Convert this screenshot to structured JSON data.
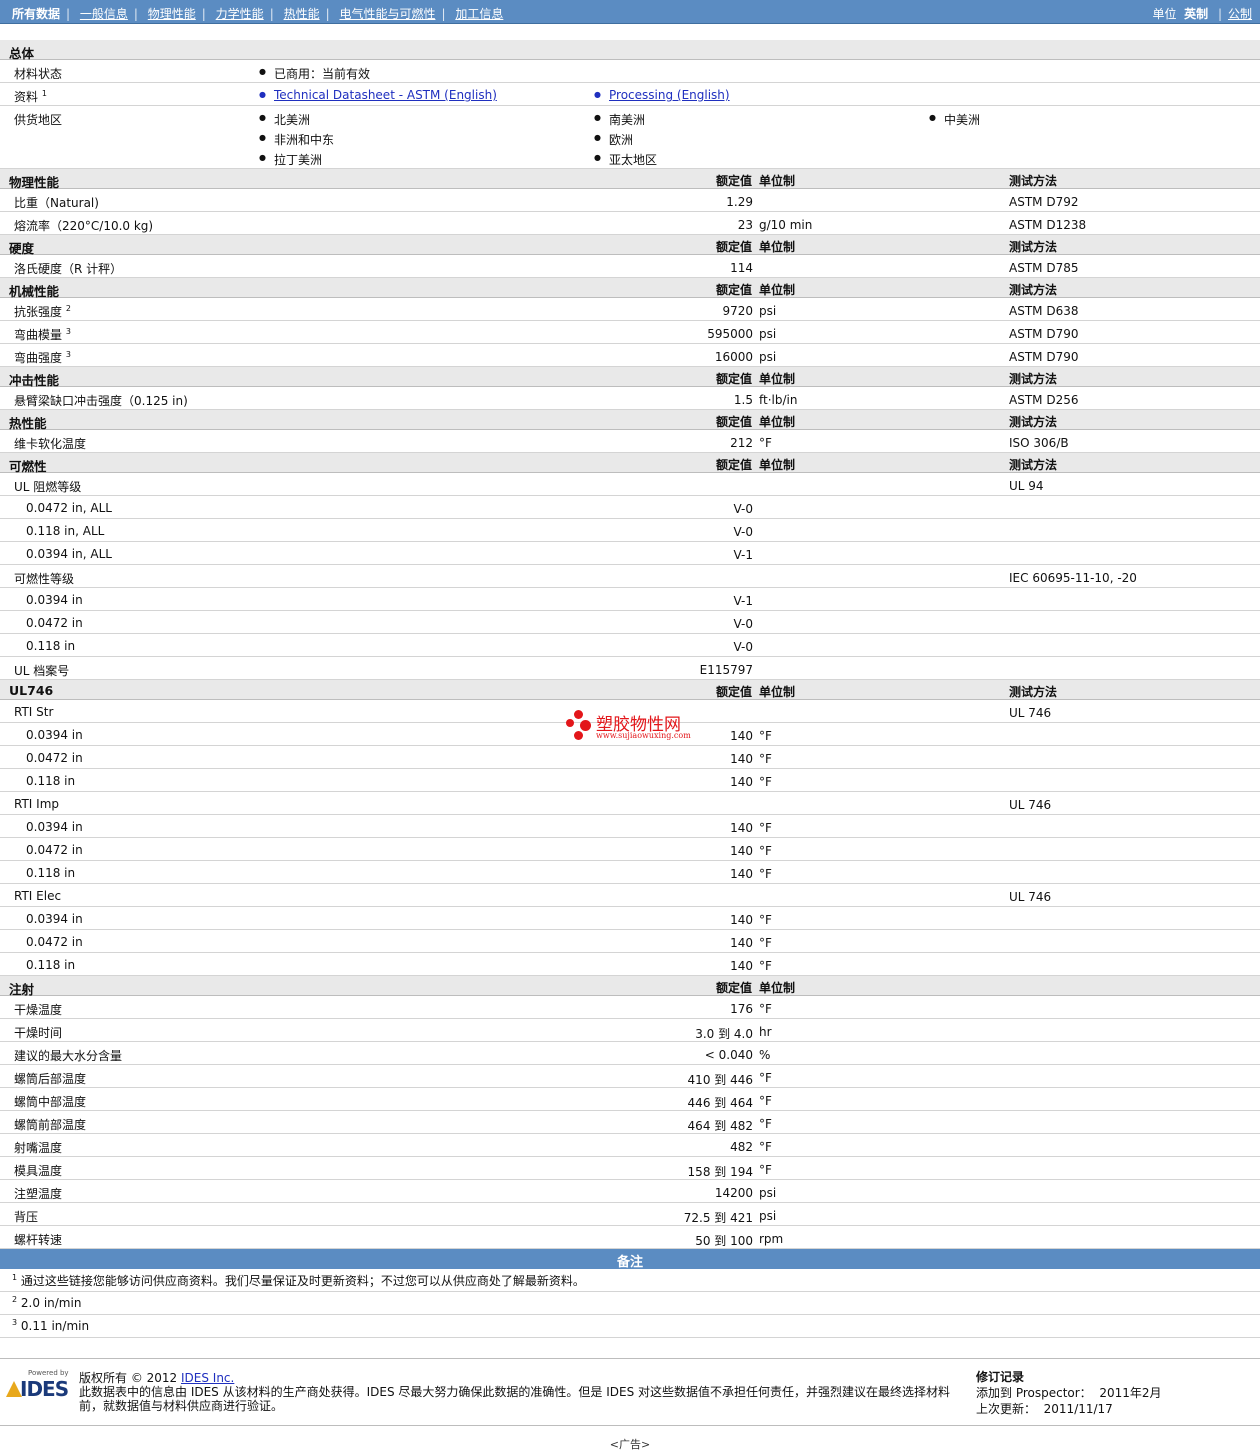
{
  "nav": {
    "tabs": [
      "所有数据",
      "一般信息",
      "物理性能",
      "力学性能",
      "热性能",
      "电气性能与可燃性",
      "加工信息"
    ],
    "units_label": "单位",
    "unit_english": "英制",
    "unit_metric": "公制"
  },
  "table_header": {
    "value": "额定值",
    "unit": "单位制",
    "method": "测试方法"
  },
  "general": {
    "title": "总体",
    "status_label": "材料状态",
    "status_value": "已商用：当前有效",
    "docs_label": "资料",
    "docs_sup": "1",
    "doc1": "Technical Datasheet - ASTM (English)",
    "doc2": "Processing (English)",
    "regions_label": "供货地区",
    "regions": [
      "北美洲",
      "南美洲",
      "中美洲",
      "非洲和中东",
      "欧洲",
      "拉丁美洲",
      "亚太地区"
    ]
  },
  "sections": [
    {
      "title": "物理性能",
      "rows": [
        {
          "label": "比重（Natural)",
          "value": "1.29",
          "unit": "",
          "method": "ASTM D792"
        },
        {
          "label": "熔流率（220°C/10.0 kg)",
          "value": "23",
          "unit": "g/10 min",
          "method": "ASTM D1238"
        }
      ]
    },
    {
      "title": "硬度",
      "rows": [
        {
          "label": "洛氏硬度（R 计秤）",
          "value": "114",
          "unit": "",
          "method": "ASTM D785"
        }
      ]
    },
    {
      "title": "机械性能",
      "rows": [
        {
          "label": "抗张强度",
          "sup": "2",
          "value": "9720",
          "unit": "psi",
          "method": "ASTM D638"
        },
        {
          "label": "弯曲模量",
          "sup": "3",
          "value": "595000",
          "unit": "psi",
          "method": "ASTM D790"
        },
        {
          "label": "弯曲强度",
          "sup": "3",
          "value": "16000",
          "unit": "psi",
          "method": "ASTM D790"
        }
      ]
    },
    {
      "title": "冲击性能",
      "rows": [
        {
          "label": "悬臂梁缺口冲击强度（0.125 in)",
          "value": "1.5",
          "unit": "ft·lb/in",
          "method": "ASTM D256"
        }
      ]
    },
    {
      "title": "热性能",
      "rows": [
        {
          "label": "维卡软化温度",
          "value": "212",
          "unit": "°F",
          "method": "ISO 306/B"
        }
      ]
    },
    {
      "title": "可燃性",
      "rows": [
        {
          "label": "UL 阻燃等级",
          "value": "",
          "unit": "",
          "method": "UL 94"
        },
        {
          "label": "0.0472 in, ALL",
          "sub": true,
          "value": "V-0",
          "unit": "",
          "method": ""
        },
        {
          "label": "0.118 in, ALL",
          "sub": true,
          "value": "V-0",
          "unit": "",
          "method": ""
        },
        {
          "label": "0.0394 in, ALL",
          "sub": true,
          "value": "V-1",
          "unit": "",
          "method": ""
        },
        {
          "label": "可燃性等级",
          "value": "",
          "unit": "",
          "method": "IEC 60695-11-10, -20"
        },
        {
          "label": "0.0394 in",
          "sub": true,
          "value": "V-1",
          "unit": "",
          "method": ""
        },
        {
          "label": "0.0472 in",
          "sub": true,
          "value": "V-0",
          "unit": "",
          "method": ""
        },
        {
          "label": "0.118 in",
          "sub": true,
          "value": "V-0",
          "unit": "",
          "method": ""
        },
        {
          "label": "UL 档案号",
          "value": "E115797",
          "unit": "",
          "method": ""
        }
      ]
    },
    {
      "title": "UL746",
      "rows": [
        {
          "label": "RTI Str",
          "value": "",
          "unit": "",
          "method": "UL 746"
        },
        {
          "label": "0.0394 in",
          "sub": true,
          "value": "140",
          "unit": "°F",
          "method": ""
        },
        {
          "label": "0.0472 in",
          "sub": true,
          "value": "140",
          "unit": "°F",
          "method": ""
        },
        {
          "label": "0.118 in",
          "sub": true,
          "value": "140",
          "unit": "°F",
          "method": ""
        },
        {
          "label": "RTI Imp",
          "value": "",
          "unit": "",
          "method": "UL 746"
        },
        {
          "label": "0.0394 in",
          "sub": true,
          "value": "140",
          "unit": "°F",
          "method": ""
        },
        {
          "label": "0.0472 in",
          "sub": true,
          "value": "140",
          "unit": "°F",
          "method": ""
        },
        {
          "label": "0.118 in",
          "sub": true,
          "value": "140",
          "unit": "°F",
          "method": ""
        },
        {
          "label": "RTI Elec",
          "value": "",
          "unit": "",
          "method": "UL 746"
        },
        {
          "label": "0.0394 in",
          "sub": true,
          "value": "140",
          "unit": "°F",
          "method": ""
        },
        {
          "label": "0.0472 in",
          "sub": true,
          "value": "140",
          "unit": "°F",
          "method": ""
        },
        {
          "label": "0.118 in",
          "sub": true,
          "value": "140",
          "unit": "°F",
          "method": ""
        }
      ]
    },
    {
      "title": "注射",
      "nomethod": true,
      "rows": [
        {
          "label": "干燥温度",
          "value": "176",
          "unit": "°F",
          "method": ""
        },
        {
          "label": "干燥时间",
          "value": "3.0 到  4.0",
          "unit": "hr",
          "method": ""
        },
        {
          "label": "建议的最大水分含量",
          "value": "< 0.040",
          "unit": "%",
          "method": ""
        },
        {
          "label": "螺筒后部温度",
          "value": "410 到  446",
          "unit": "°F",
          "method": ""
        },
        {
          "label": "螺筒中部温度",
          "value": "446 到  464",
          "unit": "°F",
          "method": ""
        },
        {
          "label": "螺筒前部温度",
          "value": "464 到  482",
          "unit": "°F",
          "method": ""
        },
        {
          "label": "射嘴温度",
          "value": "482",
          "unit": "°F",
          "method": ""
        },
        {
          "label": "模具温度",
          "value": "158 到  194",
          "unit": "°F",
          "method": ""
        },
        {
          "label": "注塑温度",
          "value": "14200",
          "unit": "psi",
          "method": ""
        },
        {
          "label": "背压",
          "value": "72.5 到  421",
          "unit": "psi",
          "method": ""
        },
        {
          "label": "螺杆转速",
          "value": "50 到  100",
          "unit": "rpm",
          "method": ""
        }
      ]
    }
  ],
  "notes": {
    "title": "备注",
    "items": [
      {
        "sup": "1",
        "text": "通过这些链接您能够访问供应商资料。我们尽量保证及时更新资料；不过您可以从供应商处了解最新资料。"
      },
      {
        "sup": "2",
        "text": "2.0 in/min"
      },
      {
        "sup": "3",
        "text": "0.11 in/min"
      }
    ]
  },
  "footer": {
    "powered_by": "Powered by",
    "logo_text": "IDES",
    "copyright_prefix": "版权所有  © 2012 ",
    "company_link": "IDES Inc.",
    "disclaimer": "此数据表中的信息由  IDES 从该材料的生产商处获得。IDES 尽最大努力确保此数据的准确性。但是  IDES 对这些数据值不承担任何责任，并强烈建议在最终选择材料前，就数据值与材料供应商进行验证。",
    "revision_title": "修订记录",
    "added_label": "添加到  Prospector：",
    "added_value": "2011年2月",
    "updated_label": "上次更新：",
    "updated_value": "2011/11/17"
  },
  "ad": "<广告>",
  "watermark": {
    "name": "塑胶物性网",
    "url": "www.sujiaowuxing.com"
  }
}
